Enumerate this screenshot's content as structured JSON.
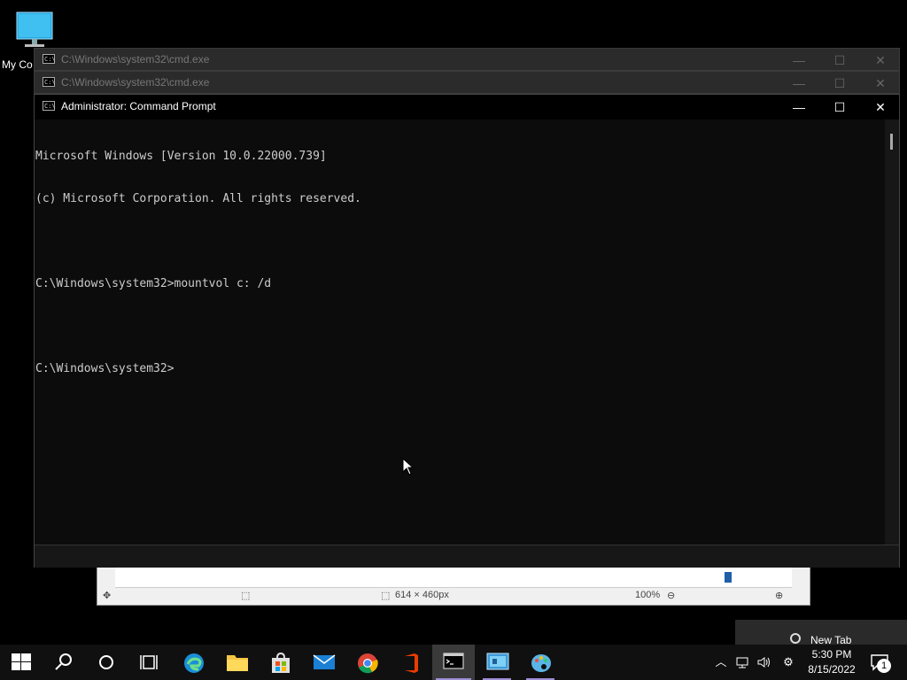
{
  "desktop": {
    "icon_label": "My Co"
  },
  "background_app": {
    "status_size": "614 × 460px",
    "zoom": "100%"
  },
  "windows": {
    "back1": {
      "title": "C:\\Windows\\system32\\cmd.exe"
    },
    "back2": {
      "title": "C:\\Windows\\system32\\cmd.exe"
    },
    "main": {
      "title": "Administrator: Command Prompt",
      "lines": [
        "Microsoft Windows [Version 10.0.22000.739]",
        "(c) Microsoft Corporation. All rights reserved.",
        "",
        "C:\\Windows\\system32>mountvol c: /d",
        "",
        "C:\\Windows\\system32>"
      ]
    }
  },
  "notification": {
    "label": "New Tab"
  },
  "taskbar": {
    "time": "5:30 PM",
    "date": "8/15/2022",
    "notification_count": "1"
  }
}
